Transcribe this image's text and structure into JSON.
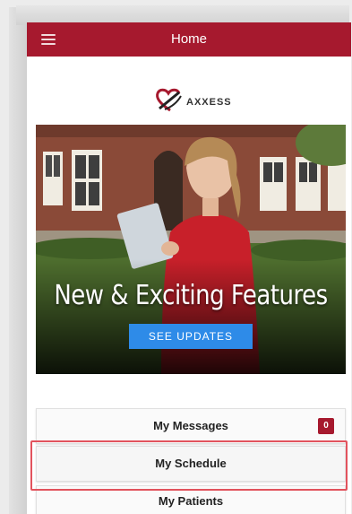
{
  "header": {
    "title": "Home",
    "color": "#a6192e"
  },
  "logo": {
    "text": "AXXESS"
  },
  "banner": {
    "headline": "New & Exciting Features",
    "button_label": "SEE UPDATES",
    "button_color": "#2e8be8"
  },
  "menu": {
    "messages": {
      "label": "My Messages",
      "badge": "0"
    },
    "schedule": {
      "label": "My Schedule"
    },
    "patients": {
      "label": "My Patients"
    }
  },
  "highlight_color": "#e2535d"
}
